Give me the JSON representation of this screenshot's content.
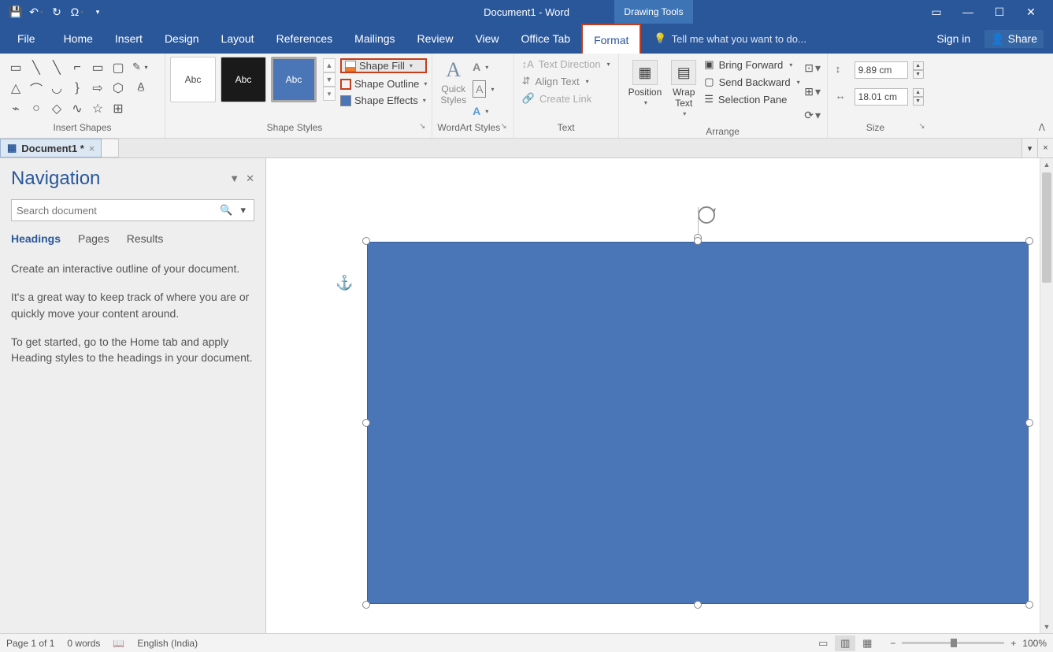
{
  "title": "Document1 - Word",
  "context_tab": "Drawing Tools",
  "tabs": [
    "File",
    "Home",
    "Insert",
    "Design",
    "Layout",
    "References",
    "Mailings",
    "Review",
    "View",
    "Office Tab",
    "Format"
  ],
  "active_tab": "Format",
  "tellme_placeholder": "Tell me what you want to do...",
  "signin": "Sign in",
  "share": "Share",
  "ribbon": {
    "insert_shapes": "Insert Shapes",
    "shape_styles": "Shape Styles",
    "wordart_styles": "WordArt Styles",
    "text_group": "Text",
    "arrange": "Arrange",
    "size": "Size",
    "abc": "Abc",
    "shape_fill": "Shape Fill",
    "shape_outline": "Shape Outline",
    "shape_effects": "Shape Effects",
    "quick_styles": "Quick\nStyles",
    "text_direction": "Text Direction",
    "align_text": "Align Text",
    "create_link": "Create Link",
    "position": "Position",
    "wrap_text": "Wrap\nText",
    "bring_forward": "Bring Forward",
    "send_backward": "Send Backward",
    "selection_pane": "Selection Pane",
    "height": "9.89 cm",
    "width": "18.01 cm"
  },
  "doctab": "Document1 *",
  "nav": {
    "title": "Navigation",
    "search_placeholder": "Search document",
    "tabs": [
      "Headings",
      "Pages",
      "Results"
    ],
    "p1": "Create an interactive outline of your document.",
    "p2": "It's a great way to keep track of where you are or quickly move your content around.",
    "p3": "To get started, go to the Home tab and apply Heading styles to the headings in your document."
  },
  "status": {
    "page": "Page 1 of 1",
    "words": "0 words",
    "lang": "English (India)",
    "zoom": "100%"
  }
}
